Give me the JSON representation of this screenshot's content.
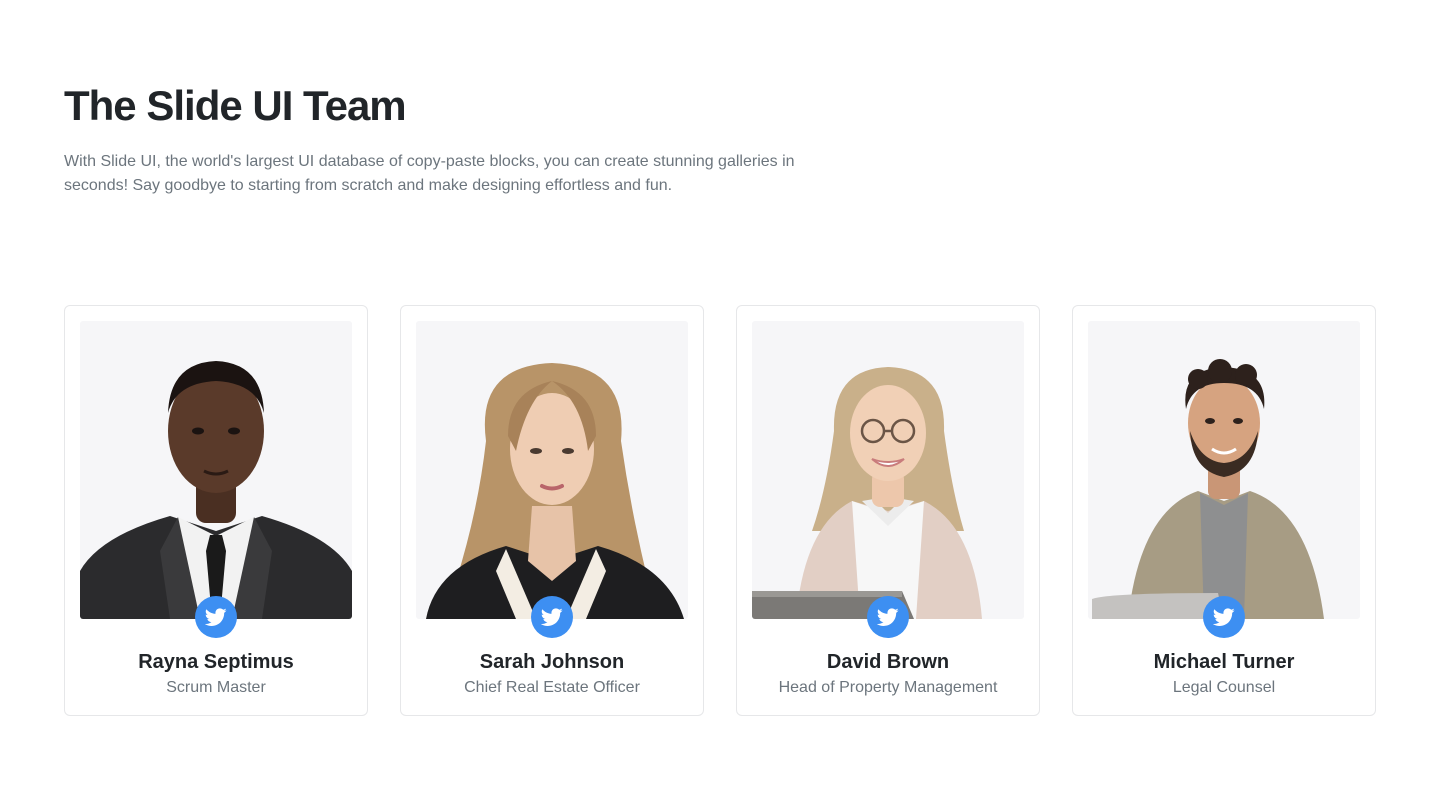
{
  "header": {
    "title": "The Slide UI Team",
    "subtitle": "With Slide UI, the world's largest UI database of copy-paste blocks, you can create stunning galleries in seconds! Say goodbye to starting from scratch and make designing effortless and fun."
  },
  "team": [
    {
      "name": "Rayna Septimus",
      "role": "Scrum Master",
      "social_icon": "twitter-icon"
    },
    {
      "name": "Sarah Johnson",
      "role": "Chief Real Estate Officer",
      "social_icon": "twitter-icon"
    },
    {
      "name": "David Brown",
      "role": "Head of Property Management",
      "social_icon": "twitter-icon"
    },
    {
      "name": "Michael Turner",
      "role": "Legal Counsel",
      "social_icon": "twitter-icon"
    }
  ],
  "colors": {
    "accent": "#3d8ff2",
    "heading": "#212529",
    "muted": "#6c757d",
    "border": "#e6e7e9",
    "photo_bg": "#f6f6f8"
  }
}
